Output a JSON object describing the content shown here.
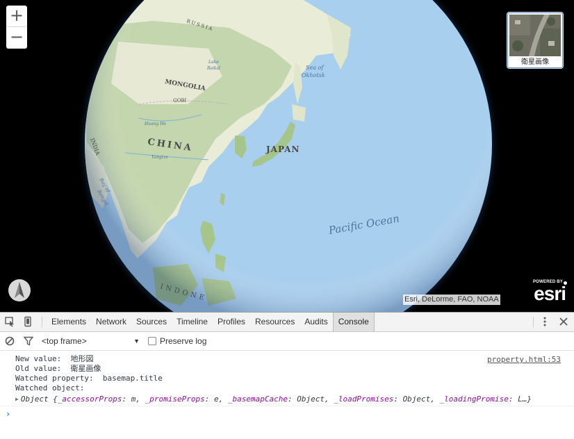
{
  "map": {
    "labels": {
      "russia": "RUSSIA",
      "mongolia": "MONGOLIA",
      "gobi": "GOBI",
      "china": "CHINA",
      "japan": "JAPAN",
      "india": "INDIA",
      "sea_of_okhotsk_1": "Sea of",
      "sea_of_okhotsk_2": "Okhotsk",
      "pacific": "Pacific Ocean",
      "lake_baikal_1": "Lake",
      "lake_baikal_2": "Baikal",
      "huang_he": "Huang He",
      "yangtze": "Yangtze",
      "bay_of_bengal_1": "Bay of",
      "bay_of_bengal_2": "Bengal",
      "indonesia": "INDONE"
    },
    "zoom_in_label": "+",
    "zoom_out_label": "−",
    "basemap_toggle_label": "衛星画像",
    "attribution": "Esri, DeLorme, FAO, NOAA",
    "esri_powered_by": "POWERED BY",
    "esri_word": "esri",
    "colors": {
      "ocean": "#a9cfee",
      "land": "#e9ecd7",
      "forest": "#a6c58a",
      "background": "#000000"
    }
  },
  "devtools": {
    "tabs": [
      "Elements",
      "Network",
      "Sources",
      "Timeline",
      "Profiles",
      "Resources",
      "Audits",
      "Console"
    ],
    "active_tab": "Console",
    "frame_select": "<top frame>",
    "preserve_log": "Preserve log",
    "console": {
      "source_link": "property.html:53",
      "lines": [
        "New value:  地形図",
        "Old value:  衛星画像",
        "Watched property:  basemap.title",
        "Watched object:"
      ],
      "object_prefix": "Object {",
      "object_props": [
        {
          "key": "_accessorProps",
          "value": "m"
        },
        {
          "key": "_promiseProps",
          "value": "e"
        },
        {
          "key": "_basemapCache",
          "value": "Object"
        },
        {
          "key": "_loadPromises",
          "value": "Object"
        },
        {
          "key": "_loadingPromise",
          "value": "L…}"
        }
      ],
      "prompt": "›"
    }
  }
}
